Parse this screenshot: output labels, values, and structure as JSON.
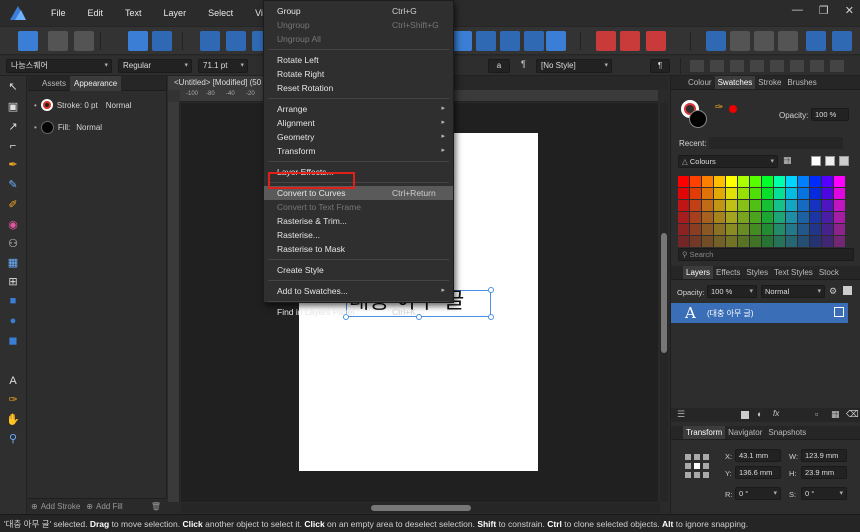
{
  "menubar": {
    "items": [
      "File",
      "Edit",
      "Text",
      "Layer",
      "Select",
      "View",
      "W"
    ]
  },
  "context_bar": {
    "font_family": "나눔스퀘어",
    "font_style": "Regular",
    "font_size": "71.1 pt",
    "style_name": "[No Style]",
    "a_glyph": "a",
    "pilcrow": "¶"
  },
  "left_panel": {
    "tabs": [
      "Assets",
      "Appearance"
    ],
    "active_tab": "Appearance",
    "stroke_label": "Stroke: 0 pt",
    "stroke_mode": "Normal",
    "fill_label": "Fill:",
    "fill_mode": "Normal",
    "add_stroke": "Add Stroke",
    "add_fill": "Add Fill"
  },
  "document": {
    "tab_title": "<Untitled> [Modified] (50",
    "text_content": "대충 아무 글",
    "ruler_labels": [
      "-100",
      "-80",
      "-40",
      "-20"
    ]
  },
  "edit_menu": {
    "items": [
      {
        "label": "Group",
        "shortcut": "Ctrl+G",
        "disabled": false
      },
      {
        "label": "Ungroup",
        "shortcut": "Ctrl+Shift+G",
        "disabled": true
      },
      {
        "label": "Ungroup All",
        "shortcut": "",
        "disabled": true
      },
      {
        "sep": true
      },
      {
        "label": "Rotate Left",
        "shortcut": "",
        "disabled": false
      },
      {
        "label": "Rotate Right",
        "shortcut": "",
        "disabled": false
      },
      {
        "label": "Reset Rotation",
        "shortcut": "",
        "disabled": false
      },
      {
        "sep": true
      },
      {
        "label": "Arrange",
        "shortcut": "",
        "submenu": true
      },
      {
        "label": "Alignment",
        "shortcut": "",
        "submenu": true
      },
      {
        "label": "Geometry",
        "shortcut": "",
        "submenu": true
      },
      {
        "label": "Transform",
        "shortcut": "",
        "submenu": true
      },
      {
        "sep": true
      },
      {
        "label": "Layer Effects...",
        "shortcut": ""
      },
      {
        "sep": true
      },
      {
        "label": "Convert to Curves",
        "shortcut": "Ctrl+Return",
        "highlighted": true
      },
      {
        "label": "Convert to Text Frame",
        "shortcut": "",
        "disabled": true
      },
      {
        "label": "Rasterise & Trim...",
        "shortcut": ""
      },
      {
        "label": "Rasterise...",
        "shortcut": ""
      },
      {
        "label": "Rasterise to Mask",
        "shortcut": ""
      },
      {
        "sep": true
      },
      {
        "label": "Create Style",
        "shortcut": ""
      },
      {
        "sep": true
      },
      {
        "label": "Add to Swatches...",
        "shortcut": "",
        "submenu": true
      },
      {
        "sep": true
      },
      {
        "label": "Find in Layers Panel",
        "shortcut": "Ctrl+K"
      }
    ]
  },
  "right_top": {
    "tabs": [
      "Colour",
      "Swatches",
      "Stroke",
      "Brushes"
    ],
    "active_tab": "Swatches",
    "opacity_label": "Opacity:",
    "opacity_value": "100 %",
    "recent_label": "Recent:",
    "palette_name": "Colours",
    "search_placeholder": "Search"
  },
  "layers": {
    "tabs": [
      "Layers",
      "Effects",
      "Styles",
      "Text Styles",
      "Stock"
    ],
    "active_tab": "Layers",
    "opacity_label": "Opacity:",
    "opacity_value": "100 %",
    "blend_mode": "Normal",
    "layer_name": "(대충 아무 글)",
    "layer_glyph": "A"
  },
  "transform": {
    "tabs": [
      "Transform",
      "Navigator",
      "Snapshots"
    ],
    "active_tab": "Transform",
    "x_label": "X:",
    "x_value": "43.1 mm",
    "y_label": "Y:",
    "y_value": "136.6 mm",
    "w_label": "W:",
    "w_value": "123.9 mm",
    "h_label": "H:",
    "h_value": "23.9 mm",
    "r_label": "R:",
    "r_value": "0 °",
    "s_label": "S:",
    "s_value": "0 °"
  },
  "status": {
    "selected_name": "'대충 아무 글'",
    "t1": " selected. ",
    "b1": "Drag",
    "t2": " to move selection. ",
    "b2": "Click",
    "t3": " another object to select it. ",
    "b3": "Click",
    "t4": " on an empty area to deselect selection. ",
    "b4": "Shift",
    "t5": " to constrain. ",
    "b5": "Ctrl",
    "t6": " to clone selected objects. ",
    "b6": "Alt",
    "t7": " to ignore snapping."
  },
  "colors": {
    "accent": "#3a7fd5",
    "highlight_box": "#e0211b",
    "layer_selected": "#3a6fb8"
  }
}
